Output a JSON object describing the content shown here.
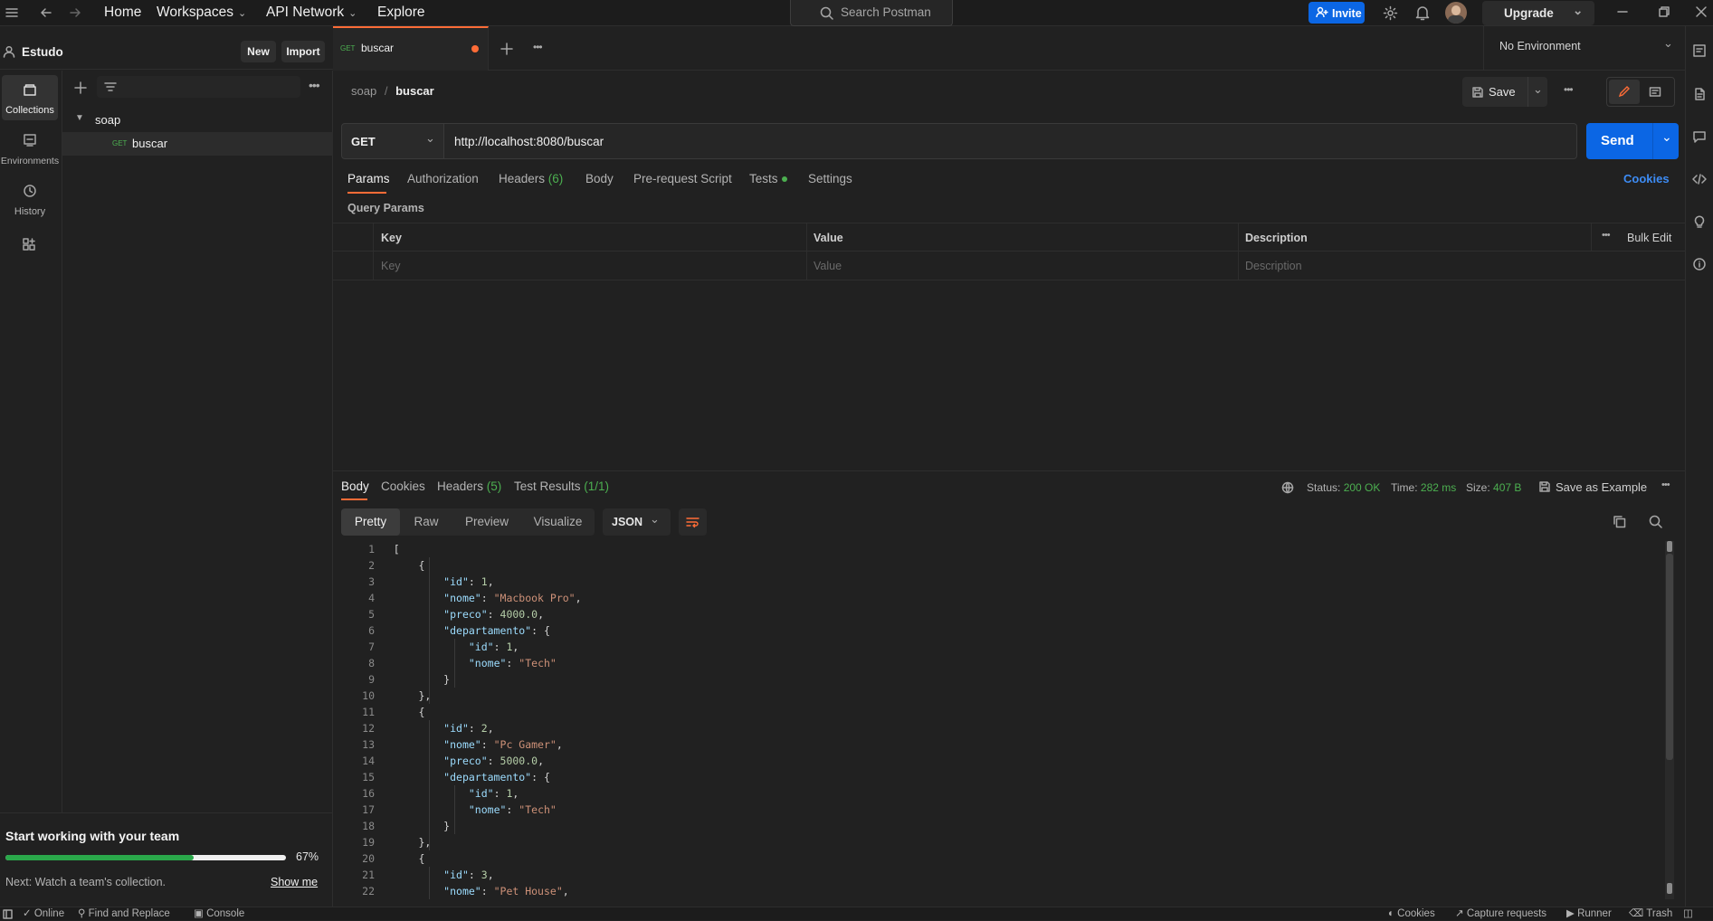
{
  "topbar": {
    "home": "Home",
    "workspaces": "Workspaces",
    "api_network": "API Network",
    "explore": "Explore",
    "search_placeholder": "Search Postman",
    "invite": "Invite",
    "upgrade": "Upgrade"
  },
  "workspace": {
    "name": "Estudo",
    "new": "New",
    "import": "Import"
  },
  "rail": {
    "collections": "Collections",
    "environments": "Environments",
    "history": "History"
  },
  "sidebar": {
    "collection": "soap",
    "request_method": "GET",
    "request_name": "buscar"
  },
  "team": {
    "title": "Start working with your team",
    "progress_percent": 67,
    "progress_label": "67%",
    "next": "Next: Watch a team's collection.",
    "show_me": "Show me"
  },
  "tab": {
    "method": "GET",
    "name": "buscar"
  },
  "environment": {
    "selected": "No Environment"
  },
  "breadcrumb": {
    "parent": "soap",
    "separator": "/",
    "current": "buscar"
  },
  "toolbar": {
    "save": "Save"
  },
  "request": {
    "method": "GET",
    "url": "http://localhost:8080/buscar",
    "send": "Send",
    "tabs": {
      "params": "Params",
      "authorization": "Authorization",
      "headers": "Headers",
      "headers_count": "(6)",
      "body": "Body",
      "prerequest": "Pre-request Script",
      "tests": "Tests",
      "settings": "Settings"
    },
    "cookies": "Cookies",
    "query_params_title": "Query Params",
    "table": {
      "key": "Key",
      "value": "Value",
      "description": "Description",
      "bulk_edit": "Bulk Edit",
      "key_ph": "Key",
      "value_ph": "Value",
      "description_ph": "Description"
    }
  },
  "response": {
    "tabs": {
      "body": "Body",
      "cookies": "Cookies",
      "headers": "Headers",
      "headers_count": "(5)",
      "tests": "Test Results",
      "tests_count": "(1/1)"
    },
    "status_label": "Status:",
    "status": "200 OK",
    "time_label": "Time:",
    "time": "282 ms",
    "size_label": "Size:",
    "size": "407 B",
    "save_example": "Save as Example",
    "formats": {
      "pretty": "Pretty",
      "raw": "Raw",
      "preview": "Preview",
      "visualize": "Visualize"
    },
    "language": "JSON",
    "lines": [
      "[",
      "    {",
      "        \"id\": 1,",
      "        \"nome\": \"Macbook Pro\",",
      "        \"preco\": 4000.0,",
      "        \"departamento\": {",
      "            \"id\": 1,",
      "            \"nome\": \"Tech\"",
      "        }",
      "    },",
      "    {",
      "        \"id\": 2,",
      "        \"nome\": \"Pc Gamer\",",
      "        \"preco\": 5000.0,",
      "        \"departamento\": {",
      "            \"id\": 1,",
      "            \"nome\": \"Tech\"",
      "        }",
      "    },",
      "    {",
      "        \"id\": 3,",
      "        \"nome\": \"Pet House\","
    ]
  },
  "statusbar": {
    "online": "Online",
    "find_replace": "Find and Replace",
    "console": "Console",
    "cookies": "Cookies",
    "capture": "Capture requests",
    "runner": "Runner",
    "trash": "Trash"
  },
  "colors": {
    "accent": "#ff6c37",
    "primary": "#0b66e4",
    "success": "#4caf50",
    "background": "#212121"
  }
}
